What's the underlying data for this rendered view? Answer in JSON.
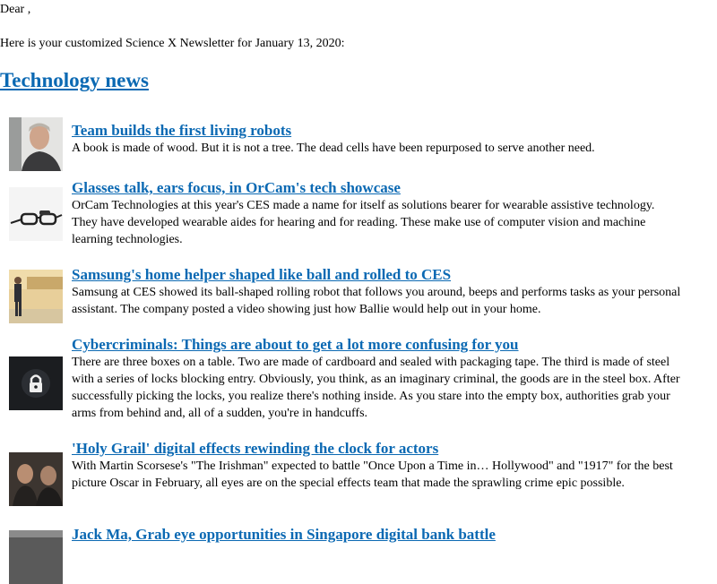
{
  "email": {
    "greeting": "Dear ,",
    "intro": "Here is your customized Science X Newsletter for January 13, 2020:"
  },
  "section": {
    "title": "Technology news"
  },
  "articles": [
    {
      "headline": "Team builds the first living robots",
      "summary": "A book is made of wood. But it is not a tree. The dead cells have been repurposed to serve another need.",
      "thumbnail_icon": "man-portrait-photo"
    },
    {
      "headline": "Glasses talk, ears focus, in OrCam's tech showcase",
      "summary": "OrCam Technologies at this year's CES made a name for itself as solutions bearer for wearable assistive technology. They have developed wearable aides for hearing and for reading. These make use of computer vision and machine learning technologies.",
      "thumbnail_icon": "glasses-photo"
    },
    {
      "headline": "Samsung's home helper shaped like ball and rolled to CES",
      "summary": "Samsung at CES showed its ball-shaped rolling robot that follows you around, beeps and performs tasks as your personal assistant. The company posted a video showing just how Ballie would help out in your home.",
      "thumbnail_icon": "presenter-stage-photo"
    },
    {
      "headline": "Cybercriminals: Things are about to get a lot more confusing for you",
      "summary": "There are three boxes on a table. Two are made of cardboard and sealed with packaging tape. The third is made of steel with a series of locks blocking entry. Obviously, you think, as an imaginary criminal, the goods are in the steel box. After successfully picking the locks, you realize there's nothing inside. As you stare into the empty box, authorities grab your arms from behind and, all of a sudden, you're in handcuffs.",
      "thumbnail_icon": "padlock-photo"
    },
    {
      "headline": "'Holy Grail' digital effects rewinding the clock for actors",
      "summary": "With Martin Scorsese's \"The Irishman\" expected to battle \"Once Upon a Time in… Hollywood\" and \"1917\" for the best picture Oscar in February, all eyes are on the special effects team that made the sprawling crime epic possible.",
      "thumbnail_icon": "film-still-photo"
    },
    {
      "headline": "Jack Ma, Grab eye opportunities in Singapore digital bank battle",
      "summary": "",
      "thumbnail_icon": "news-photo"
    }
  ]
}
